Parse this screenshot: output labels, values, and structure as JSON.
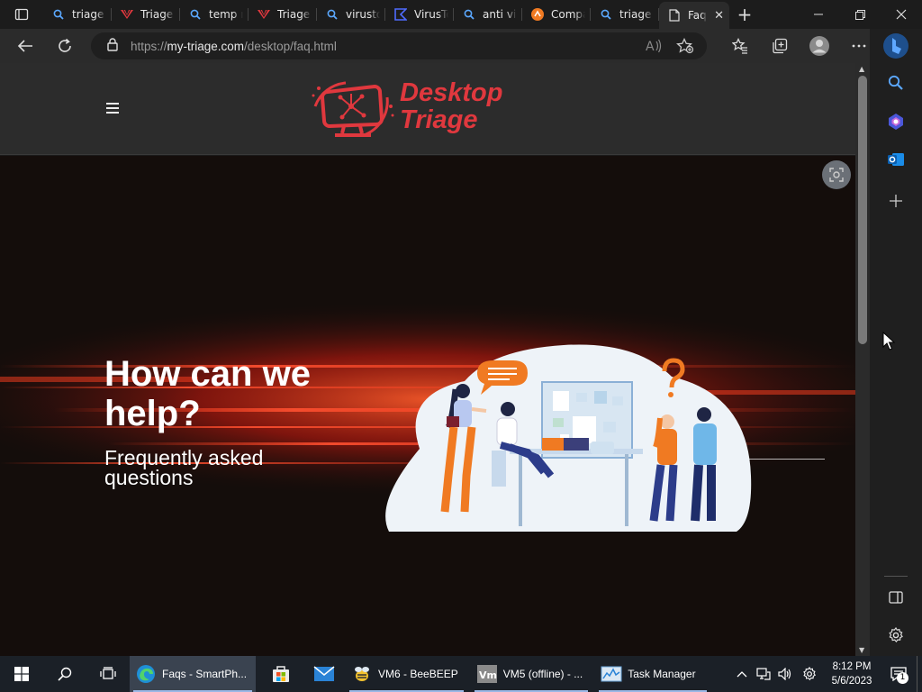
{
  "browser": {
    "tabs": [
      {
        "label": "triage v",
        "icon": "search-icon"
      },
      {
        "label": "Triage |",
        "icon": "triage-logo-icon"
      },
      {
        "label": "temp m",
        "icon": "search-icon"
      },
      {
        "label": "Triage |",
        "icon": "triage-logo-icon"
      },
      {
        "label": "virustot",
        "icon": "search-icon"
      },
      {
        "label": "VirusTo",
        "icon": "virustotal-icon"
      },
      {
        "label": "anti vir",
        "icon": "search-icon"
      },
      {
        "label": "Compa",
        "icon": "compare-site-icon"
      },
      {
        "label": "triage c",
        "icon": "search-icon"
      },
      {
        "label": "Faq",
        "icon": "page-icon",
        "active": true
      }
    ],
    "address": {
      "scheme": "https://",
      "host": "my-triage.com",
      "path": "/desktop/faq.html"
    }
  },
  "site": {
    "logo_line1": "Desktop",
    "logo_line2": "Triage",
    "brand_color": "#e0383e"
  },
  "hero": {
    "title": "How can we help?",
    "subtitle": "Frequently asked questions"
  },
  "taskbar": {
    "apps": [
      {
        "label": "Faqs - SmartPh...",
        "icon": "edge-icon",
        "active": true
      },
      {
        "label": "",
        "icon": "store-icon"
      },
      {
        "label": "",
        "icon": "mail-icon"
      },
      {
        "label": "VM6 - BeeBEEP",
        "icon": "beebeep-icon"
      },
      {
        "label": "VM5 (offline) - ...",
        "icon": "vmware-icon"
      },
      {
        "label": "Task Manager",
        "icon": "task-manager-icon"
      }
    ],
    "time": "8:12 PM",
    "date": "5/6/2023",
    "notification_count": "1"
  }
}
